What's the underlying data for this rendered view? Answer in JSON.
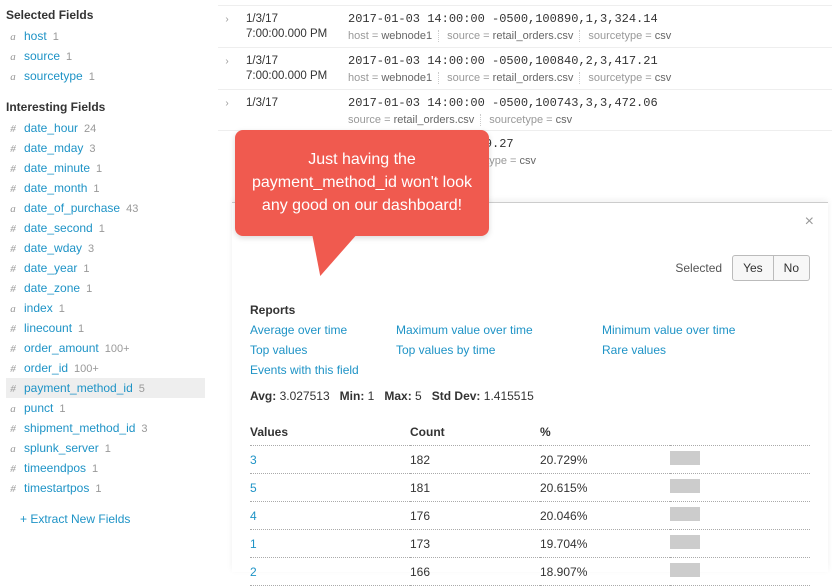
{
  "sidebar": {
    "selected_title": "Selected Fields",
    "selected_fields": [
      {
        "prefix": "a",
        "name": "host",
        "count": "1"
      },
      {
        "prefix": "a",
        "name": "source",
        "count": "1"
      },
      {
        "prefix": "a",
        "name": "sourcetype",
        "count": "1"
      }
    ],
    "interesting_title": "Interesting Fields",
    "interesting_fields": [
      {
        "prefix": "#",
        "name": "date_hour",
        "count": "24"
      },
      {
        "prefix": "#",
        "name": "date_mday",
        "count": "3"
      },
      {
        "prefix": "#",
        "name": "date_minute",
        "count": "1"
      },
      {
        "prefix": "#",
        "name": "date_month",
        "count": "1"
      },
      {
        "prefix": "a",
        "name": "date_of_purchase",
        "count": "43"
      },
      {
        "prefix": "#",
        "name": "date_second",
        "count": "1"
      },
      {
        "prefix": "#",
        "name": "date_wday",
        "count": "3"
      },
      {
        "prefix": "#",
        "name": "date_year",
        "count": "1"
      },
      {
        "prefix": "#",
        "name": "date_zone",
        "count": "1"
      },
      {
        "prefix": "a",
        "name": "index",
        "count": "1"
      },
      {
        "prefix": "#",
        "name": "linecount",
        "count": "1"
      },
      {
        "prefix": "#",
        "name": "order_amount",
        "count": "100+"
      },
      {
        "prefix": "#",
        "name": "order_id",
        "count": "100+"
      },
      {
        "prefix": "#",
        "name": "payment_method_id",
        "count": "5",
        "hl": true
      },
      {
        "prefix": "a",
        "name": "punct",
        "count": "1"
      },
      {
        "prefix": "#",
        "name": "shipment_method_id",
        "count": "3"
      },
      {
        "prefix": "a",
        "name": "splunk_server",
        "count": "1"
      },
      {
        "prefix": "#",
        "name": "timeendpos",
        "count": "1"
      },
      {
        "prefix": "#",
        "name": "timestartpos",
        "count": "1"
      }
    ],
    "extract_label": "+ Extract New Fields"
  },
  "events": [
    {
      "date": "",
      "time": "7:00:00.000 PM",
      "raw": "",
      "host": "webnode1",
      "source": "retail_orders.csv",
      "sourcetype": "csv"
    },
    {
      "date": "1/3/17",
      "time": "7:00:00.000 PM",
      "raw": "2017-01-03 14:00:00 -0500,100890,1,3,324.14",
      "host": "webnode1",
      "source": "retail_orders.csv",
      "sourcetype": "csv"
    },
    {
      "date": "1/3/17",
      "time": "7:00:00.000 PM",
      "raw": "2017-01-03 14:00:00 -0500,100840,2,3,417.21",
      "host": "webnode1",
      "source": "retail_orders.csv",
      "sourcetype": "csv"
    },
    {
      "date": "1/3/17",
      "time": "",
      "raw": "2017-01-03 14:00:00 -0500,100743,3,3,472.06",
      "host": "",
      "source": "retail_orders.csv",
      "sourcetype": "csv"
    },
    {
      "date": "",
      "time": "",
      "raw": "-0500,100725,2,1,269.27",
      "host": "",
      "source": "retail_orders.csv",
      "sourcetype": "csv",
      "prefixHidden": true
    }
  ],
  "evt_labels": {
    "host_k": "host = ",
    "source_k": "source = ",
    "sourcetype_k": "sourcetype = "
  },
  "panel": {
    "selected_label": "Selected",
    "yes": "Yes",
    "no": "No",
    "reports_title": "Reports",
    "report_links": {
      "avg": "Average over time",
      "max": "Maximum value over time",
      "min": "Minimum value over time",
      "top": "Top values",
      "topbytime": "Top values by time",
      "rare": "Rare values",
      "withfield": "Events with this field"
    },
    "stats": {
      "avg_l": "Avg:",
      "avg": "3.027513",
      "min_l": "Min:",
      "min": "1",
      "max_l": "Max:",
      "max": "5",
      "std_l": "Std Dev:",
      "std": "1.415515"
    },
    "cols": {
      "values": "Values",
      "count": "Count",
      "pct": "%"
    },
    "rows": [
      {
        "v": "3",
        "c": "182",
        "p": "20.729%"
      },
      {
        "v": "5",
        "c": "181",
        "p": "20.615%"
      },
      {
        "v": "4",
        "c": "176",
        "p": "20.046%"
      },
      {
        "v": "1",
        "c": "173",
        "p": "19.704%"
      },
      {
        "v": "2",
        "c": "166",
        "p": "18.907%"
      }
    ]
  },
  "callout": "Just having the payment_method_id won't look any good on our dashboard!"
}
